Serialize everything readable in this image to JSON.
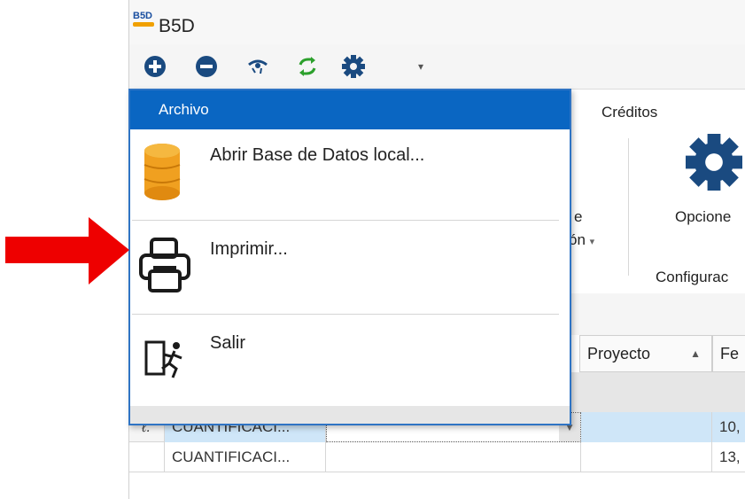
{
  "app": {
    "logo_text": "B5D",
    "title": "B5D"
  },
  "ribbon": {
    "tab_creditos": "Créditos",
    "partial_e": "e",
    "partial_on": "ón",
    "opciones": "Opcione",
    "configuracion": "Configurac"
  },
  "grid": {
    "headers": {
      "proyecto": "Proyecto",
      "fecha": "Fe"
    },
    "rows": [
      {
        "marker": "ℓ.",
        "name": "CUANTIFICACI...",
        "fecha": "10,"
      },
      {
        "marker": "",
        "name": "CUANTIFICACI...",
        "fecha": "13,"
      }
    ]
  },
  "menu": {
    "header": "Archivo",
    "items": [
      {
        "label": "Abrir Base de Datos local...",
        "icon": "database-icon"
      },
      {
        "label": "Imprimir...",
        "icon": "printer-icon"
      },
      {
        "label": "Salir",
        "icon": "exit-door-icon"
      }
    ]
  },
  "colors": {
    "menu_header": "#0a66c2",
    "arrow": "#ee0000",
    "toolbar_icons": "#1a4a80",
    "refresh": "#2ca02c",
    "db": "#f0a020",
    "selected_row": "#cfe6f8"
  }
}
